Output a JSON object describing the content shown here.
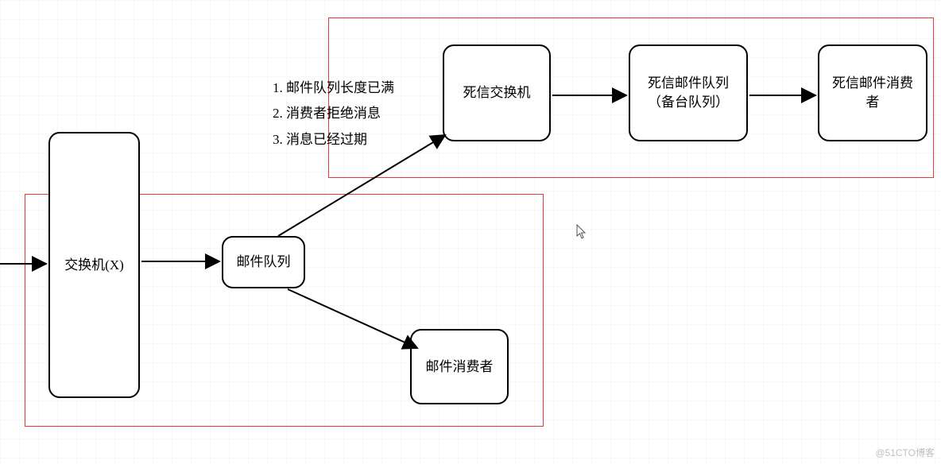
{
  "nodes": {
    "exchangeX": "交换机(X)",
    "mailQueue": "邮件队列",
    "mailConsumer": "邮件消费者",
    "deadExchange": "死信交换机",
    "deadQueue": "死信邮件队列\n（备台队列）",
    "deadConsumer": "死信邮件消费\n者"
  },
  "annotations": {
    "line1": "1. 邮件队列长度已满",
    "line2": "2. 消费者拒绝消息",
    "line3": "3. 消息已经过期"
  },
  "watermark": "@51CTO博客"
}
